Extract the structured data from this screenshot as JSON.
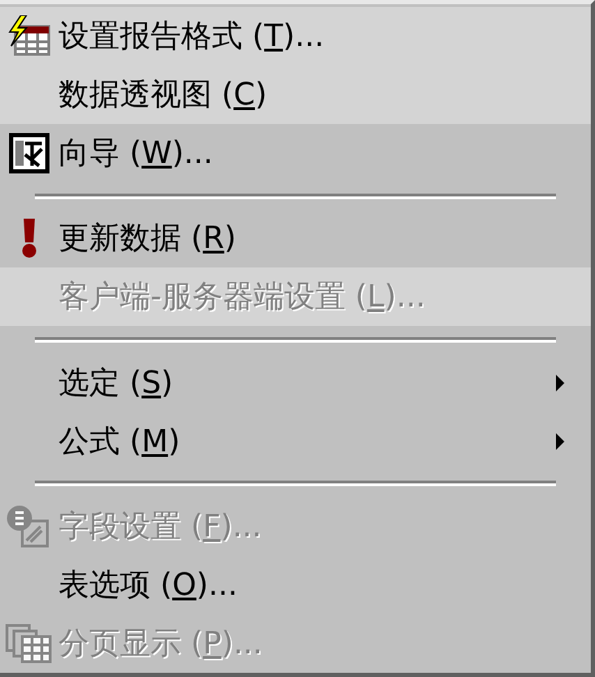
{
  "menu": {
    "items": [
      {
        "kind": "format-table",
        "before": "设置报告格式 (",
        "accel": "T",
        "after": ")...",
        "disabled": false,
        "rarely_used": true,
        "submenu": false
      },
      {
        "kind": "plain",
        "before": "数据透视图 (",
        "accel": "C",
        "after": ")",
        "disabled": false,
        "rarely_used": true,
        "submenu": false
      },
      {
        "kind": "wizard",
        "before": "向导 (",
        "accel": "W",
        "after": ")...",
        "disabled": false,
        "rarely_used": false,
        "submenu": false
      },
      {
        "kind": "separator"
      },
      {
        "kind": "exclamation",
        "before": "更新数据 (",
        "accel": "R",
        "after": ")",
        "disabled": false,
        "rarely_used": false,
        "submenu": false
      },
      {
        "kind": "plain",
        "before": "客户端-服务器端设置 (",
        "accel": "L",
        "after": ")...",
        "disabled": true,
        "rarely_used": true,
        "submenu": false
      },
      {
        "kind": "separator"
      },
      {
        "kind": "plain",
        "before": "选定 (",
        "accel": "S",
        "after": ")",
        "disabled": false,
        "rarely_used": false,
        "submenu": true
      },
      {
        "kind": "plain",
        "before": "公式 (",
        "accel": "M",
        "after": ")",
        "disabled": false,
        "rarely_used": false,
        "submenu": true
      },
      {
        "kind": "separator"
      },
      {
        "kind": "field",
        "before": "字段设置 (",
        "accel": "F",
        "after": ")...",
        "disabled": true,
        "rarely_used": false,
        "submenu": false
      },
      {
        "kind": "plain",
        "before": "表选项 (",
        "accel": "O",
        "after": ")...",
        "disabled": false,
        "rarely_used": false,
        "submenu": false
      },
      {
        "kind": "pages",
        "before": "分页显示 (",
        "accel": "P",
        "after": ")...",
        "disabled": true,
        "rarely_used": false,
        "submenu": false
      }
    ]
  }
}
